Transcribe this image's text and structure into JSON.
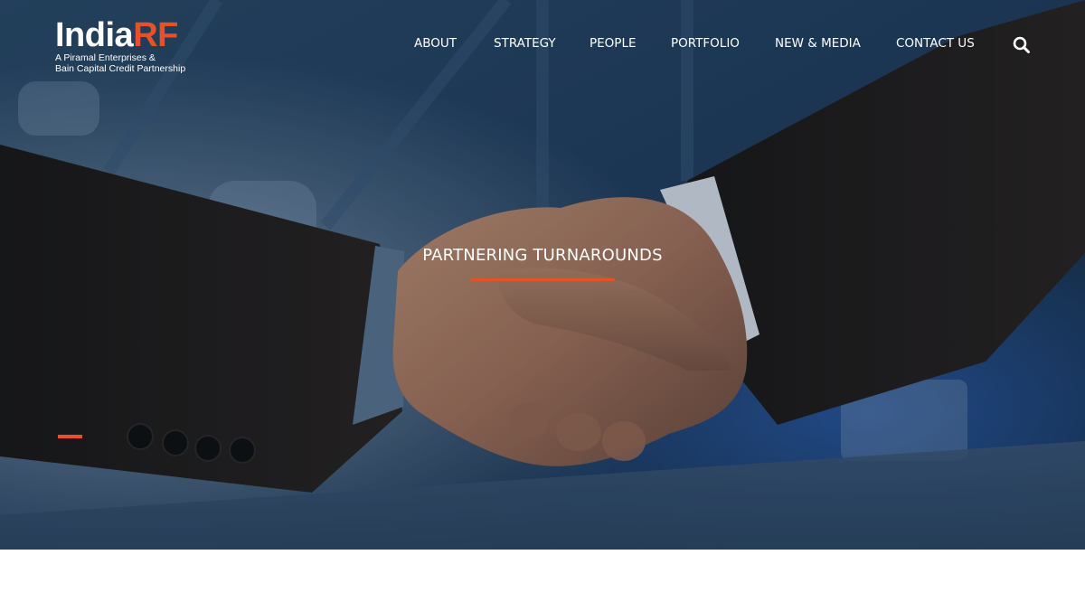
{
  "brand": {
    "name_part1": "India",
    "name_part2": "RF",
    "tagline_line1": "A Piramal Enterprises &",
    "tagline_line2": "Bain Capital Credit Partnership",
    "accent_color": "#e8502a"
  },
  "nav": {
    "items": [
      {
        "label": "ABOUT"
      },
      {
        "label": "STRATEGY"
      },
      {
        "label": "PEOPLE"
      },
      {
        "label": "PORTFOLIO"
      },
      {
        "label": "NEW & MEDIA"
      },
      {
        "label": "CONTACT US"
      }
    ],
    "search_icon": "search-icon"
  },
  "hero": {
    "headline": "PARTNERING TURNAROUNDS",
    "image": "handshake-photo"
  }
}
